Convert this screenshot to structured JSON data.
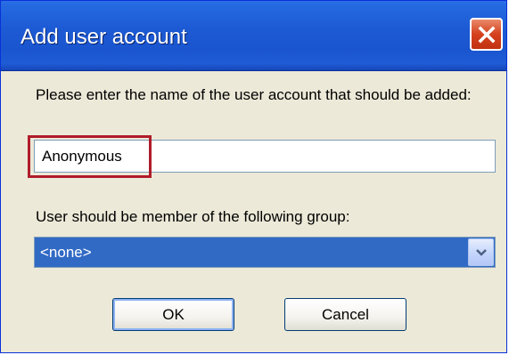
{
  "window": {
    "title": "Add user account"
  },
  "form": {
    "prompt": "Please enter the name of the user account that should be added:",
    "name_value": "Anonymous",
    "group_label": "User should be member of the following group:",
    "group_selected": "<none>"
  },
  "buttons": {
    "ok_label": "OK",
    "cancel_label": "Cancel"
  },
  "icons": {
    "close": "close-icon",
    "dropdown": "chevron-down-icon"
  },
  "colors": {
    "titlebar": "#1a55cf",
    "close_button": "#d5411d",
    "selection": "#316ac5",
    "highlight_box": "#b01c2a"
  }
}
